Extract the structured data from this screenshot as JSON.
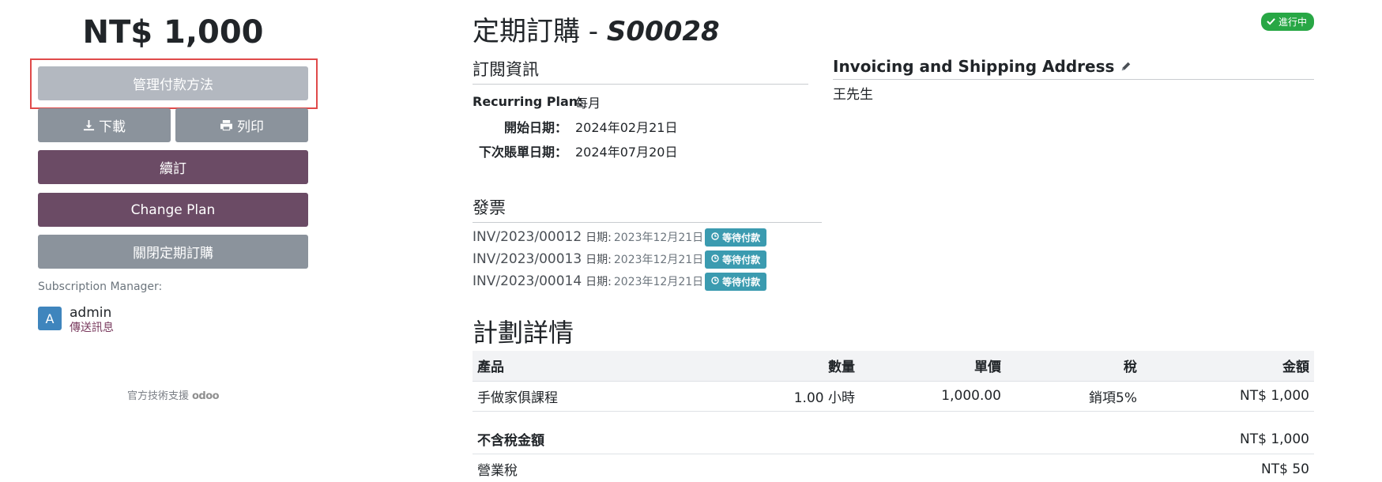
{
  "sidebar": {
    "amount": "NT$ 1,000",
    "manage_payment": "管理付款方法",
    "download": "下載",
    "print": "列印",
    "renew": "續訂",
    "change_plan": "Change Plan",
    "close_subscription": "關閉定期訂購",
    "manager_label": "Subscription Manager:",
    "manager_avatar": "A",
    "manager_name": "admin",
    "send_message": "傳送訊息",
    "powered_by": "官方技術支援",
    "odoo": "odoo"
  },
  "header": {
    "title_prefix": "定期訂購 - ",
    "reference": "S00028",
    "state": "進行中"
  },
  "subscription_info": {
    "heading": "訂閱資訊",
    "rows": [
      {
        "label": "Recurring Plan:",
        "value": "每月"
      },
      {
        "label": "開始日期：",
        "value": "2024年02月21日"
      },
      {
        "label": "下次賬單日期：",
        "value": "2024年07月20日"
      }
    ]
  },
  "address": {
    "heading": "Invoicing and Shipping Address",
    "name": "王先生"
  },
  "invoices": {
    "heading": "發票",
    "date_label": "日期:",
    "items": [
      {
        "number": "INV/2023/00012",
        "date": "2023年12月21日",
        "status": "等待付款"
      },
      {
        "number": "INV/2023/00013",
        "date": "2023年12月21日",
        "status": "等待付款"
      },
      {
        "number": "INV/2023/00014",
        "date": "2023年12月21日",
        "status": "等待付款"
      }
    ]
  },
  "plan": {
    "heading": "計劃詳情",
    "columns": [
      "產品",
      "數量",
      "單價",
      "稅",
      "金額"
    ],
    "lines": [
      {
        "product": "手做家俱課程",
        "quantity": "1.00 小時",
        "unit_price": "1,000.00",
        "tax": "銷項5%",
        "amount": "NT$ 1,000"
      }
    ],
    "untaxed_label": "不含稅金額",
    "untaxed_value": "NT$ 1,000",
    "tax_label": "營業稅",
    "tax_value": "NT$ 50"
  },
  "colors": {
    "primary": "#6b4b65",
    "secondary": "#8b939c",
    "disabled": "#b3b8c0",
    "success": "#28a745",
    "info": "#3b9bb0",
    "highlight": "#e04a4a"
  }
}
